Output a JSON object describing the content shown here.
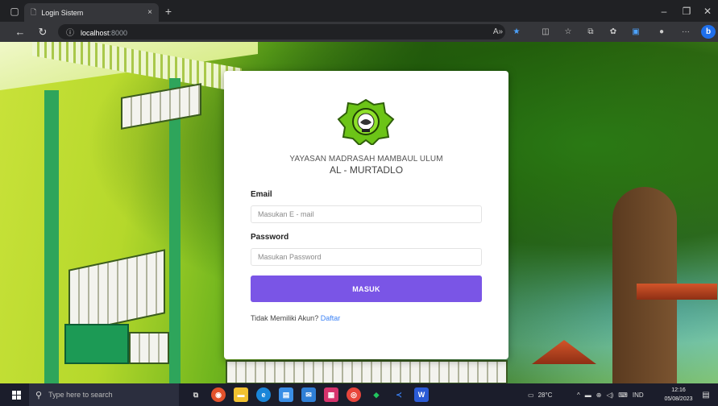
{
  "browser": {
    "tab_title": "Login Sistem",
    "tab_close": "×",
    "new_tab": "+",
    "url_host": "localhost",
    "url_port": ":8000"
  },
  "login": {
    "org_name_line1": "YAYASAN MADRASAH MAMBAUL ULUM",
    "org_name_line2": "AL - MURTADLO",
    "email_label": "Email",
    "email_placeholder": "Masukan E - mail",
    "email_value": "",
    "password_label": "Password",
    "password_placeholder": "Masukan Password",
    "password_value": "",
    "submit_label": "MASUK",
    "register_prompt": "Tidak Memiliki Akun?",
    "register_link": "Daftar"
  },
  "taskbar": {
    "search_placeholder": "Type here to search",
    "weather": "28°C",
    "language": "IND",
    "time": "12:16",
    "date": "05/08/2023"
  },
  "colors": {
    "accent_button": "#7a55e6",
    "link": "#3b82f6",
    "browser_dark": "#202124",
    "taskbar": "#1b1d2b"
  }
}
